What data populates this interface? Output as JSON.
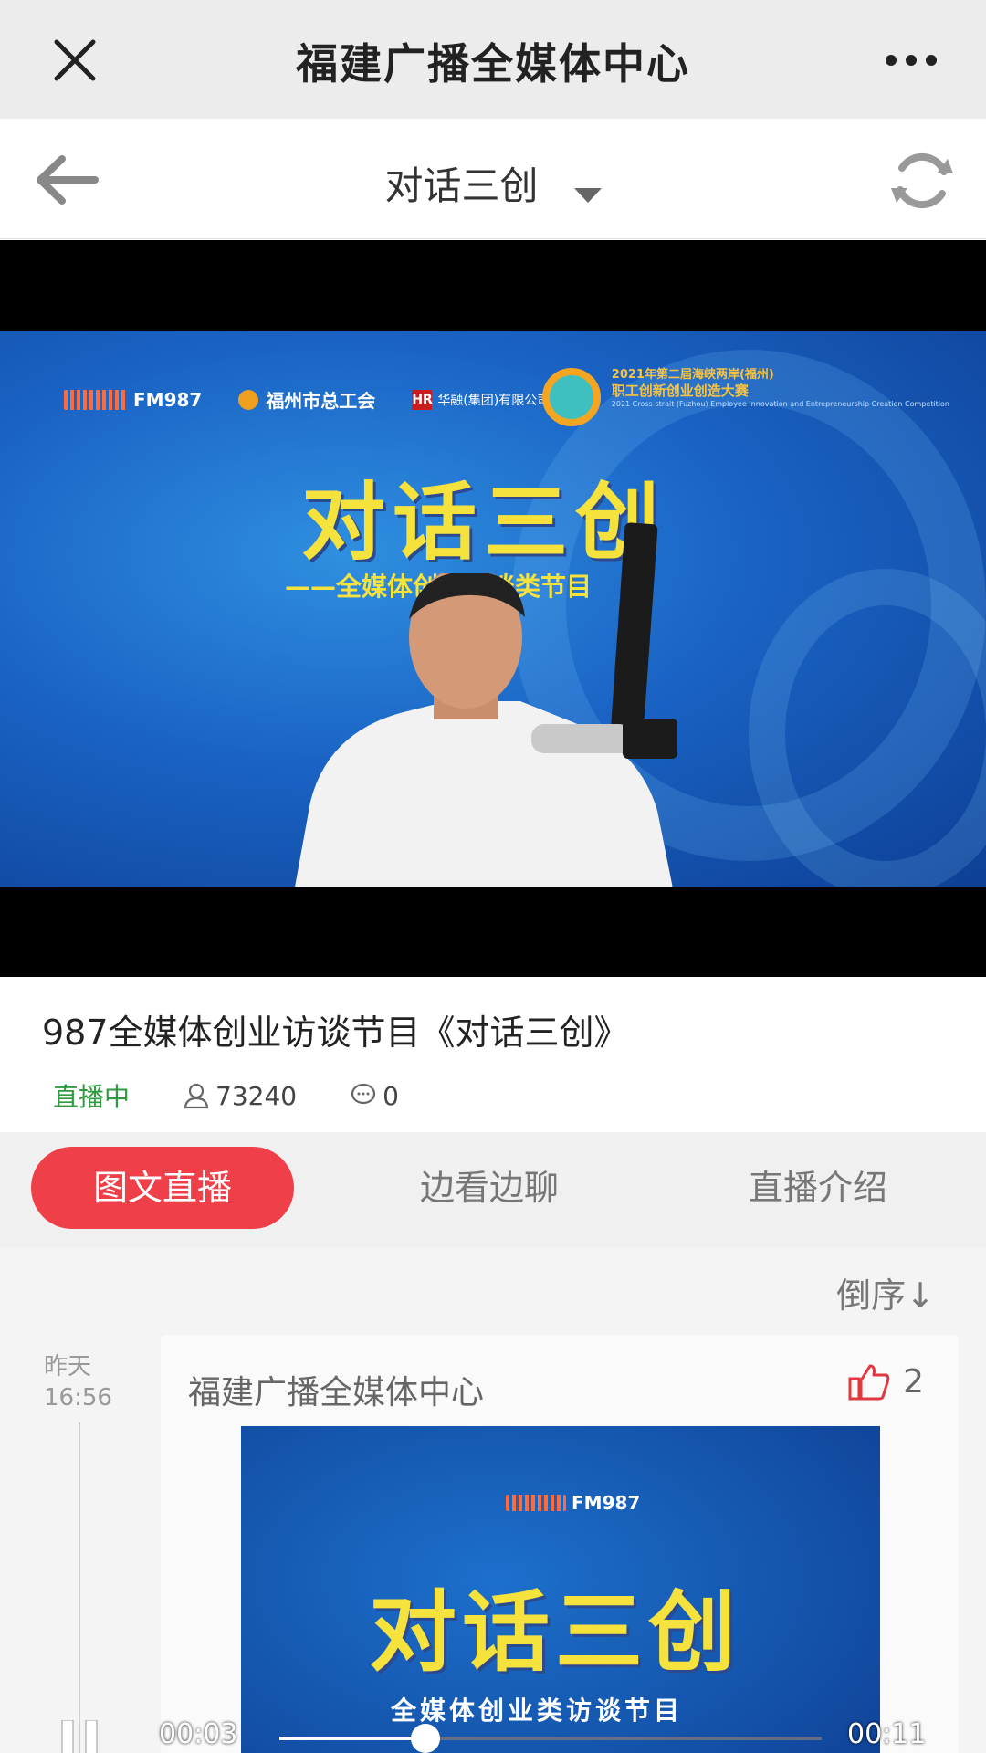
{
  "app": {
    "title": "福建广播全媒体中心"
  },
  "nav": {
    "title": "对话三创"
  },
  "video": {
    "logos": {
      "fm": "FM987",
      "union": "福州市总工会",
      "hr_mark": "HR",
      "hr": "华融(集团)有限公司"
    },
    "contest": {
      "line1": "2021年第二届海峡两岸(福州)",
      "line2": "职工创新创业创造大赛",
      "line3": "2021 Cross-strait (Fuzhou) Employee Innovation and Entrepreneurship Creation Competition"
    },
    "show_title": "对话三创",
    "show_subtitle": "——全媒体创业访谈类节目"
  },
  "program": {
    "title": "987全媒体创业访谈节目《对话三创》",
    "status": "直播中",
    "viewers": "73240",
    "comments": "0"
  },
  "tabs": [
    {
      "label": "图文直播",
      "active": true
    },
    {
      "label": "边看边聊",
      "active": false
    },
    {
      "label": "直播介绍",
      "active": false
    }
  ],
  "feed": {
    "sort_label": "倒序↓",
    "post": {
      "day": "昨天",
      "time": "16:56",
      "author": "福建广播全媒体中心",
      "likes": "2",
      "image": {
        "fm": "FM987",
        "title": "对话三创",
        "subtitle": "全媒体创业类访谈节目"
      }
    }
  },
  "player": {
    "current": "00:03",
    "duration": "00:11",
    "progress": 0.27
  },
  "colors": {
    "accent": "#ef3f48",
    "live": "#2e9b3e",
    "title_yellow": "#f5e23c"
  }
}
